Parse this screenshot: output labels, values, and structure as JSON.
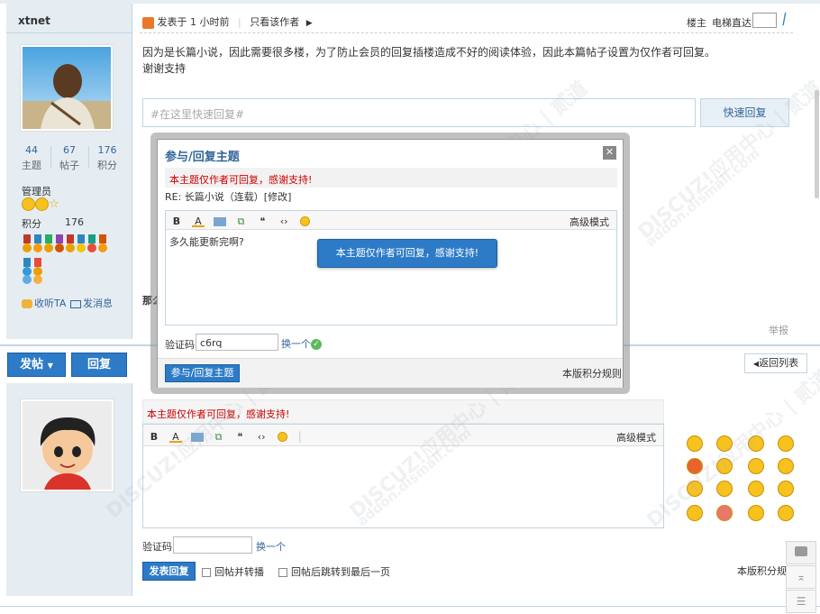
{
  "post1": {
    "author": "xtnet",
    "stats": [
      {
        "num": "44",
        "label": "主题"
      },
      {
        "num": "67",
        "label": "帖子"
      },
      {
        "num": "176",
        "label": "积分"
      }
    ],
    "role": "管理员",
    "points_label": "积分",
    "points_value": "176",
    "follow_label": "收听TA",
    "message_label": "发消息",
    "posted_time": "发表于 1 小时前",
    "only_author": "只看该作者",
    "floor_label": "楼主",
    "elevator_label": "电梯直达",
    "content_line1": "因为是长篇小说，因此需要很多楼，为了防止会员的回复插楼造成不好的阅读体验，因此本篇帖子设置为仅作者可回复。",
    "content_line2": "谢谢支持",
    "quick_reply_placeholder": "#在这里快速回复#",
    "quick_reply_button": "快速回复",
    "report_label": "举报",
    "partial_label": "那么"
  },
  "actions": {
    "new_post": "发帖",
    "reply": "回复",
    "back_to_list": "返回列表"
  },
  "modal": {
    "title": "参与/回复主题",
    "notice": "本主题仅作者可回复，感谢支持!",
    "re_line": "RE: 长篇小说（连载）[修改]",
    "advanced_mode": "高级模式",
    "content": "多久能更新完啊?",
    "popup_message": "本主题仅作者可回复，感谢支持!",
    "captcha_label": "验证码",
    "captcha_value": "c6rq",
    "change_captcha": "换一个",
    "submit": "参与/回复主题",
    "rules": "本版积分规则"
  },
  "reply_form": {
    "notice": "本主题仅作者可回复，感谢支持!",
    "advanced_mode": "高级模式",
    "captcha_label": "验证码",
    "change_captcha": "换一个",
    "submit": "发表回复",
    "option_repost": "回帖并转播",
    "option_jump_last": "回帖后跳转到最后一页",
    "rules": "本版积分规则"
  },
  "watermark": "DISCUZ!应用中心 | 贰道",
  "watermark2": "addon.dismall.com"
}
